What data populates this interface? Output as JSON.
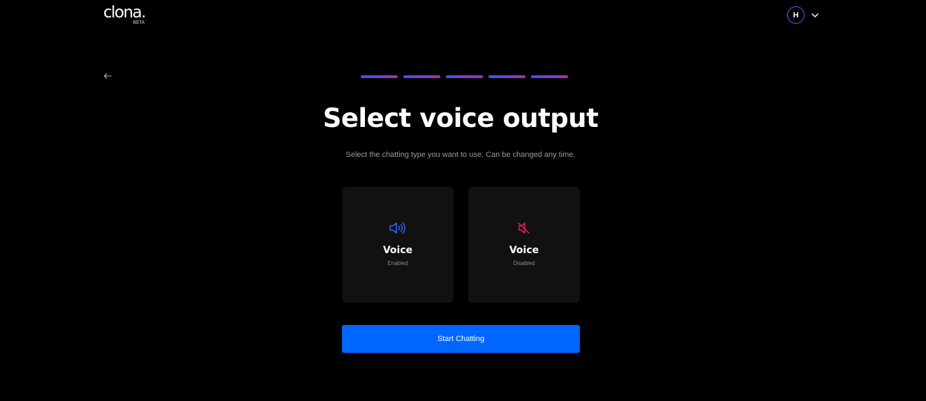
{
  "header": {
    "logo_text": "clona.",
    "logo_badge": "BETA",
    "user_initial": "H"
  },
  "progress": {
    "total_steps": 5,
    "completed_steps": 5
  },
  "main": {
    "title": "Select voice output",
    "subtitle": "Select the chatting type you want to use. Can be changed any time."
  },
  "options": [
    {
      "title": "Voice",
      "subtitle": "Enabled",
      "icon": "speaker-on-icon",
      "icon_color": "#2f6bff"
    },
    {
      "title": "Voice",
      "subtitle": "Disabled",
      "icon": "speaker-muted-icon",
      "icon_color": "#e0245e"
    }
  ],
  "cta": {
    "label": "Start Chatting"
  },
  "colors": {
    "background": "#000000",
    "card_background": "#111111",
    "accent_blue": "#0066ff",
    "step_gradient_start": "#3f55e8",
    "step_gradient_end": "#b52a9e"
  }
}
